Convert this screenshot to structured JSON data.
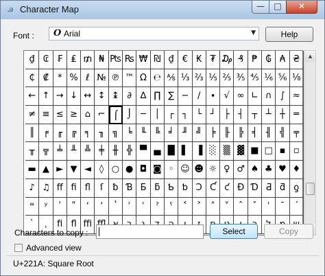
{
  "window": {
    "title": "Character Map",
    "minimize_glyph": "—",
    "maximize_glyph": "□",
    "close_glyph": "✕"
  },
  "font": {
    "label": "Font :",
    "selected": "Arial",
    "type_glyph": "O",
    "arrow_glyph": "▼"
  },
  "help_label": "Help",
  "grid": {
    "selected_index": 66,
    "cells": [
      "₫",
      "₢",
      "₣",
      "₤",
      "₥",
      "₦",
      "₧",
      "₨",
      "₩",
      "₪",
      "₫",
      "€",
      "₭",
      "₮",
      "₯",
      "₰",
      "₱",
      "₲",
      "₳",
      "₴",
      "₵",
      "₡",
      "*",
      "%",
      "ℓ",
      "№",
      "℗",
      "™",
      "Ω",
      "℮",
      "⅍",
      "⅓",
      "⅔",
      "⅕",
      "⅖",
      "⅗",
      "⅘",
      "⅙",
      "⅚",
      "⅛",
      "←",
      "↑",
      "→",
      "↓",
      "↔",
      "↕",
      "↨",
      "∂",
      "∆",
      "∏",
      "∑",
      "−",
      "∕",
      "∙",
      "√",
      "∞",
      "∟",
      "∩",
      "∫",
      "≈",
      "≠",
      "≡",
      "≤",
      "≥",
      "⌂",
      "⌐",
      "⌠",
      "⌡",
      "─",
      "│",
      "┌",
      "┐",
      "└",
      "┘",
      "├",
      "┤",
      "┬",
      "┴",
      "┼",
      "═",
      "║",
      "╒",
      "╓",
      "╔",
      "╕",
      "╖",
      "╗",
      "╘",
      "╙",
      "╚",
      "╛",
      "╜",
      "╝",
      "╞",
      "╟",
      "╠",
      "╡",
      "╢",
      "╣",
      "╤",
      "╥",
      "╦",
      "╧",
      "╨",
      "╩",
      "╪",
      "╫",
      "╬",
      "▀",
      "▄",
      "█",
      "▌",
      "▐",
      "░",
      "▒",
      "▓",
      "■",
      "□",
      "▪",
      "▫",
      "▬",
      "▲",
      "►",
      "▼",
      "◄",
      "◊",
      "○",
      "●",
      "◘",
      "◙",
      "◦",
      "☺",
      "☻",
      "☼",
      "♀",
      "♂",
      "♠",
      "♣",
      "♥",
      "♦",
      "♪",
      "♫",
      "ﬀ",
      "ﬁ",
      "ﬂ",
      "ſ",
      "ƀ",
      "Ɓ",
      "Ƃ",
      "ƃ",
      "Ƅ",
      "ƅ",
      "Ɔ",
      "Ƈ",
      "ƈ",
      "Ɖ",
      "Ɗ",
      "Ƌ",
      "ƌ",
      "ƍ",
      "ʷ",
      "ʸ",
      "ʹ",
      "ʺ",
      "ʻ",
      "ʼ",
      "ʽ",
      "ʾ",
      "ʿ",
      "ˀ",
      "ˁ",
      "˂",
      "˃",
      "˄",
      "˅",
      "ˆ",
      "ˇ",
      "ˈ",
      "ˉ",
      "ˊ",
      "ˋ",
      "ˌ",
      "ﬁ",
      "ﬂ",
      "ﬃ",
      "ﬄ",
      "א",
      "ב",
      "ג",
      "ד",
      "ה",
      "ו",
      "ז",
      "ח",
      "ט",
      "י",
      "כ",
      "ל",
      "מ",
      "ש"
    ]
  },
  "scrollbar": {
    "up_glyph": "▲",
    "down_glyph": "▼",
    "position_fraction": 0.8
  },
  "copy": {
    "label": "Characters to copy :",
    "value": "",
    "select_label": "Select",
    "copy_label": "Copy"
  },
  "advanced": {
    "label": "Advanced view",
    "checked": false
  },
  "status": "U+221A: Square Root"
}
